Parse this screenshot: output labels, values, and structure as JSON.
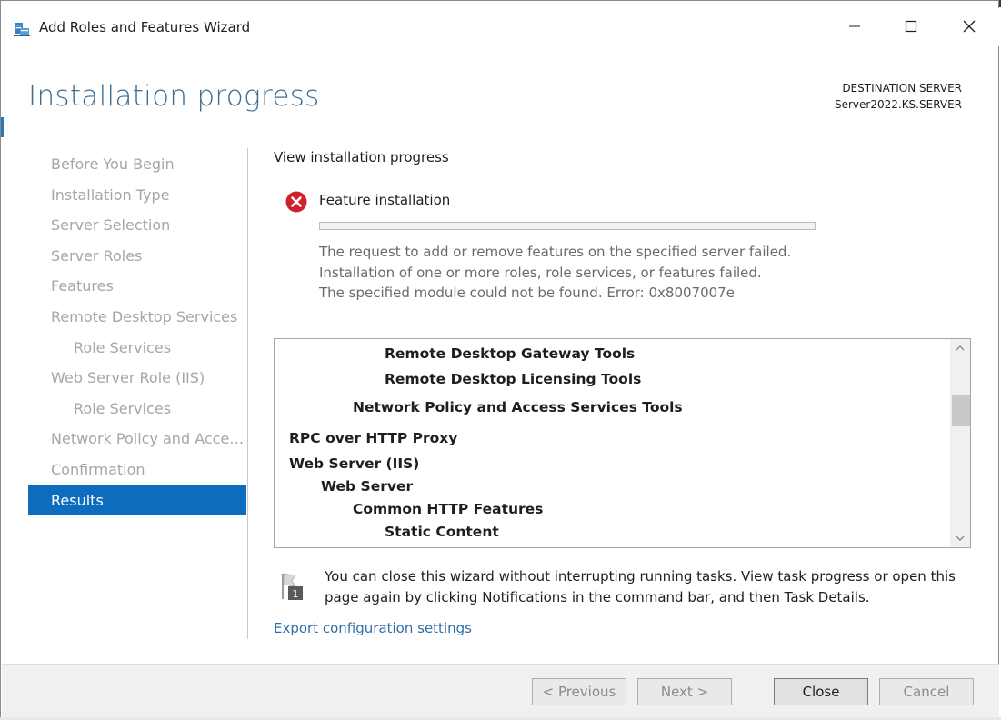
{
  "window": {
    "title": "Add Roles and Features Wizard",
    "minimize_glyph": "—",
    "maximize_glyph": "☐",
    "close_glyph": "✕"
  },
  "header": {
    "page_title": "Installation progress",
    "destination_label": "DESTINATION SERVER",
    "destination_value": "Server2022.KS.SERVER"
  },
  "nav": {
    "items": [
      {
        "label": "Before You Begin"
      },
      {
        "label": "Installation Type"
      },
      {
        "label": "Server Selection"
      },
      {
        "label": "Server Roles"
      },
      {
        "label": "Features"
      },
      {
        "label": "Remote Desktop Services"
      },
      {
        "label": "Role Services"
      },
      {
        "label": "Web Server Role (IIS)"
      },
      {
        "label": "Role Services"
      },
      {
        "label": "Network Policy and Acces..."
      },
      {
        "label": "Confirmation"
      },
      {
        "label": "Results"
      }
    ]
  },
  "main": {
    "section_title": "View installation progress",
    "feature_label": "Feature installation",
    "progress": 0,
    "error_lines": [
      "The request to add or remove features on the specified server failed.",
      "Installation of one or more roles, role services, or features failed.",
      "The specified module could not be found. Error: 0x8007007e"
    ],
    "tree_items": [
      {
        "label": "Remote Desktop Gateway Tools"
      },
      {
        "label": "Remote Desktop Licensing Tools"
      },
      {
        "label": "Network Policy and Access Services Tools"
      },
      {
        "label": "RPC over HTTP Proxy"
      },
      {
        "label": "Web Server (IIS)"
      },
      {
        "label": "Web Server"
      },
      {
        "label": "Common HTTP Features"
      },
      {
        "label": "Static Content"
      }
    ],
    "info_text": "You can close this wizard without interrupting running tasks. View task progress or open this page again by clicking Notifications in the command bar, and then Task Details.",
    "info_badge": "1",
    "export_link": "Export configuration settings"
  },
  "footer": {
    "previous": "< Previous",
    "next": "Next >",
    "close": "Close",
    "cancel": "Cancel"
  },
  "colors": {
    "accent": "#0e6cbf",
    "title": "#3b6e8f",
    "error": "#d0202e",
    "link": "#2f6fa8"
  }
}
